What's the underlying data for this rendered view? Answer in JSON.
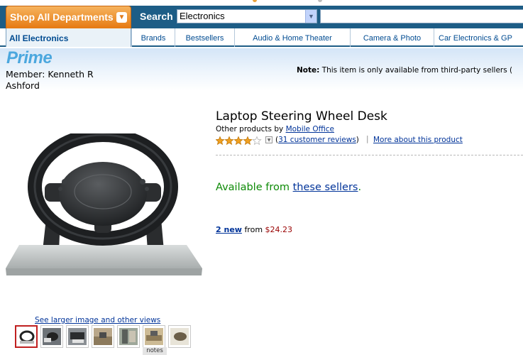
{
  "header": {
    "shop_all": "Shop All Departments",
    "search_label": "Search",
    "category_value": "Electronics",
    "search_value": "",
    "store_tab": "All Electronics",
    "subnav": [
      "Brands",
      "Bestsellers",
      "Audio & Home Theater",
      "Camera & Photo",
      "Car Electronics & GP"
    ]
  },
  "prime": {
    "logo": "Prime",
    "member": "Member: Kenneth R Ashford"
  },
  "note": {
    "label": "Note:",
    "text": "This item is only available from third-party sellers ("
  },
  "product": {
    "title": "Laptop Steering Wheel Desk",
    "other_products_prefix": "Other products by",
    "brand_link": "Mobile Office",
    "rating": 4,
    "rating_max": 5,
    "reviews_open": "(",
    "reviews_link": "31 customer reviews",
    "reviews_close": ")",
    "separator": "|",
    "more_about": "More about this product",
    "available_prefix": "Available from",
    "available_link": "these sellers",
    "available_suffix": ".",
    "offers_link": "2 new",
    "offers_from": "from",
    "offers_price": "$24.23"
  },
  "gallery": {
    "larger_link": "See larger image and other views",
    "thumbnail_count": 7,
    "notes_label": "notes"
  },
  "colors": {
    "header_blue": "#1d5d86",
    "shop_orange": "#e67a12",
    "link_blue": "#003399",
    "available_green": "#0d8a06",
    "price_red": "#990000",
    "star_gold": "#f0a020",
    "prime_blue": "#4ba7de"
  }
}
